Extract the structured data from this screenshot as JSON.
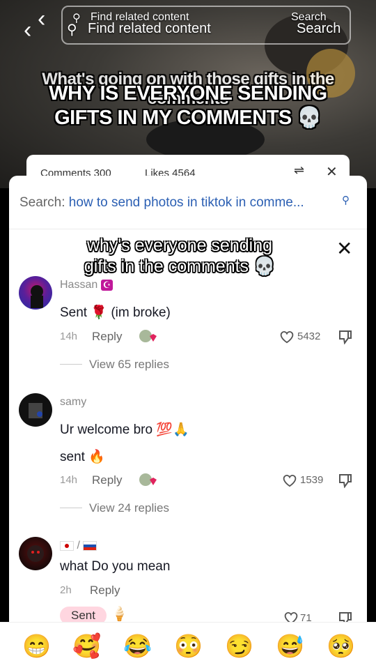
{
  "top_bar": {
    "search_placeholder_a": "Find related content",
    "search_placeholder_b": "Find related content",
    "search_button_a": "Search",
    "search_button_b": "Search"
  },
  "video_captions": {
    "caption_back": "What's going on with those gifts in the comments",
    "caption_line1": "WHY IS EVERYONE SENDING",
    "caption_line2": "GIFTS IN MY COMMENTS"
  },
  "back_panel": {
    "comments": "Comments 300",
    "likes": "Likes 4564"
  },
  "panel": {
    "search_label": "Search:",
    "search_query": "how to send photos in tiktok in comme...",
    "sticker_line1": "why's everyone sending",
    "sticker_line2": "gifts in the comments"
  },
  "comments": [
    {
      "username": "Hassan",
      "lines": [
        "Sent",
        "(im broke)"
      ],
      "time": "14h",
      "reply_label": "Reply",
      "likes": "5432",
      "view_replies": "View 65 replies"
    },
    {
      "username": "samy",
      "lines": [
        "Ur welcome bro",
        "sent"
      ],
      "time": "14h",
      "reply_label": "Reply",
      "likes": "1539",
      "view_replies": "View 24 replies"
    },
    {
      "username": "/",
      "lines": [
        "what Do you mean"
      ],
      "time": "2h",
      "reply_label": "Reply",
      "chip": "Sent",
      "likes": "71"
    }
  ],
  "emoji_bar": [
    "😁",
    "🥰",
    "😂",
    "😳",
    "😏",
    "😅",
    "🥺"
  ],
  "colors": {
    "search_query": "#2b5fb3",
    "sent_chip_bg": "#ffd6e0",
    "heart_outline": "#555555"
  }
}
